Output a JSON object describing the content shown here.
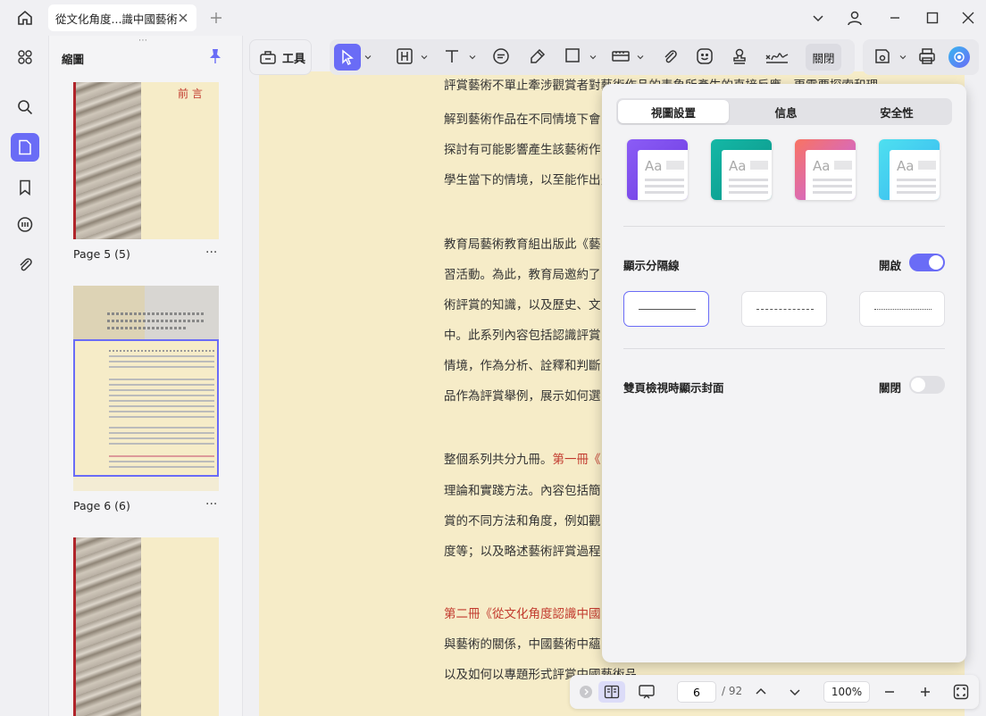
{
  "window": {
    "tab_title": "從文化角度...識中國藝術"
  },
  "sidebar": {
    "panel_title": "縮圖",
    "grip": "⋯",
    "thumbnails": [
      {
        "label": "Page 5 (5)",
        "heading": "前 言",
        "more": "···"
      },
      {
        "label": "Page 6 (6)",
        "more": "···"
      },
      {
        "label": "",
        "more": ""
      }
    ]
  },
  "toolbar": {
    "tools_label": "工具",
    "close_label": "關閉"
  },
  "document": {
    "lines": [
      "評賞藝術不單止牽涉觀賞者對藝術作品的表象所產生的直接反應，更需要探索和理",
      "解到藝術作品在不同情境下會",
      "探討有可能影響產生該藝術作",
      "學生當下的情境，以至能作出多",
      "教育局藝術教育組出版此《藝",
      "習活動。為此，教育局邀約了",
      "術評賞的知識，以及歷史、文",
      "中。此系列內容包括認識評賞",
      "情境，作為分析、詮釋和判斷",
      "品作為評賞舉例，展示如何選",
      "整個系列共分九冊。",
      "第一冊《",
      "理論和實踐方法。內容包括簡",
      "賞的不同方法和角度，例如觀",
      "度等；以及略述藝術評賞過程",
      "第二冊《從文化角度認識中國",
      "與藝術的關係，中國藝術中蘊",
      "以及如何以專題形式評賞中國藝術品。"
    ]
  },
  "settings_popup": {
    "tabs": [
      "視圖設置",
      "信息",
      "安全性"
    ],
    "active_tab": "視圖設置",
    "themes": [
      {
        "name": "purple",
        "color_a": "#8b5cf6",
        "color_b": "#6d3be0"
      },
      {
        "name": "teal",
        "color_a": "#14b8a6",
        "color_b": "#0d9488"
      },
      {
        "name": "gradient",
        "color_a": "#f97362",
        "color_b": "#c264f5"
      },
      {
        "name": "cyan",
        "color_a": "#4ee0f0",
        "color_b": "#38b6f0"
      }
    ],
    "show_divider": {
      "label": "顯示分隔線",
      "state": "開啟",
      "on": true
    },
    "line_styles": [
      "solid",
      "dashed",
      "dotted"
    ],
    "selected_line_style": "solid",
    "two_page_cover": {
      "label": "雙頁檢視時顯示封面",
      "state": "關閉",
      "on": false
    }
  },
  "bottom_bar": {
    "current_page": "6",
    "total_pages": "/ 92",
    "zoom": "100%"
  },
  "colors": {
    "accent": "#6a6cf6",
    "page_bg": "#f6ecc8",
    "red_text": "#c23a2e"
  }
}
